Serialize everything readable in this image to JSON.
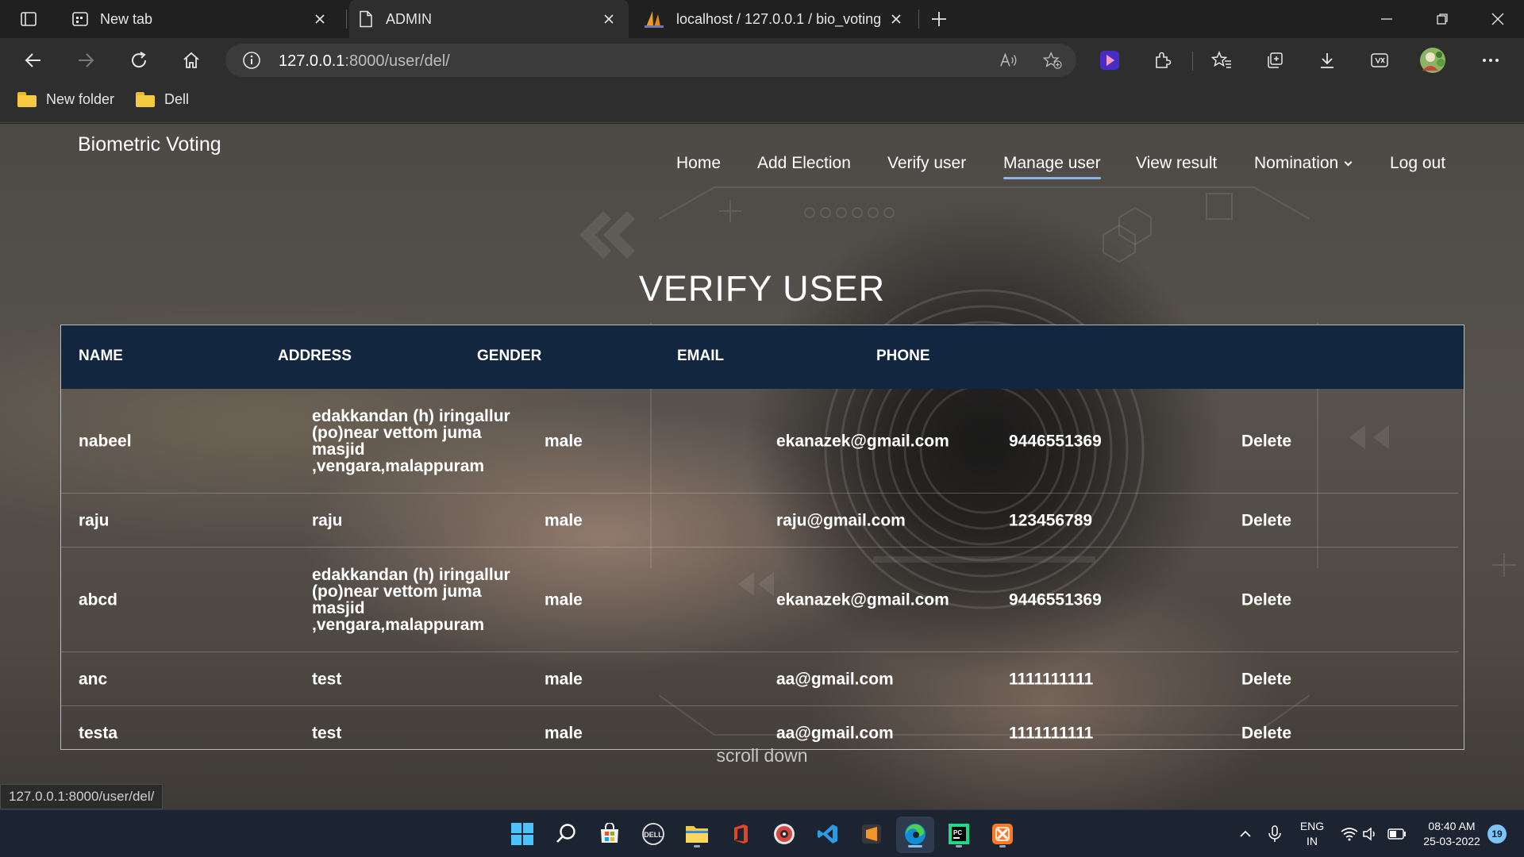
{
  "browser": {
    "tabs": [
      {
        "title": "New tab",
        "icon": "new-tab-page-icon",
        "active": false
      },
      {
        "title": "ADMIN",
        "icon": "document-icon",
        "active": true
      },
      {
        "title": "localhost / 127.0.0.1 / bio_voting",
        "icon": "phpmyadmin-sail-icon",
        "active": false
      }
    ],
    "url_host": "127.0.0.1",
    "url_rest": ":8000/user/del/",
    "bookmarks": [
      {
        "label": "New folder",
        "icon": "folder-icon"
      },
      {
        "label": "Dell",
        "icon": "folder-icon"
      }
    ],
    "status_url": "127.0.0.1:8000/user/del/"
  },
  "site": {
    "brand": "Biometric Voting",
    "nav": {
      "home": "Home",
      "add_election": "Add Election",
      "verify_user": "Verify user",
      "manage_user": "Manage user",
      "view_result": "View result",
      "nomination": "Nomination",
      "logout": "Log out"
    },
    "active_nav": "Manage user",
    "page_title": "VERIFY USER",
    "table": {
      "headers": {
        "name": "NAME",
        "address": "ADDRESS",
        "gender": "GENDER",
        "email": "EMAIL",
        "phone": "PHONE"
      },
      "rows": [
        {
          "name": "nabeel",
          "address_lines": [
            "edakkandan (h) iringallur",
            "(po)near vettom juma",
            "masjid",
            ",vengara,malappuram"
          ],
          "gender": "male",
          "email": "ekanazek@gmail.com",
          "phone": "9446551369",
          "action": "Delete"
        },
        {
          "name": "raju",
          "address_lines": [
            "raju"
          ],
          "gender": "male",
          "email": "raju@gmail.com",
          "phone": "123456789",
          "action": "Delete"
        },
        {
          "name": "abcd",
          "address_lines": [
            "edakkandan (h) iringallur",
            "(po)near vettom juma",
            "masjid",
            ",vengara,malappuram"
          ],
          "gender": "male",
          "email": "ekanazek@gmail.com",
          "phone": "9446551369",
          "action": "Delete"
        },
        {
          "name": "anc",
          "address_lines": [
            "test"
          ],
          "gender": "male",
          "email": "aa@gmail.com",
          "phone": "1111111111",
          "action": "Delete"
        },
        {
          "name": "testa",
          "address_lines": [
            "test"
          ],
          "gender": "male",
          "email": "aa@gmail.com",
          "phone": "1111111111",
          "action": "Delete"
        }
      ]
    },
    "scroll_hint": "scroll down"
  },
  "taskbar": {
    "apps": [
      "windows-start-icon",
      "search-icon",
      "microsoft-store-icon",
      "dell-icon",
      "file-explorer-icon",
      "office-icon",
      "media-player-icon",
      "vscode-icon",
      "sublime-text-icon",
      "edge-browser-icon",
      "pycharm-icon",
      "xampp-icon"
    ],
    "language_top": "ENG",
    "language_bottom": "IN",
    "time": "08:40 AM",
    "date": "25-03-2022",
    "notifications": "19"
  },
  "colors": {
    "table_header_bg": "#12263f",
    "active_nav_underline": "#8fb2e8",
    "taskbar_bg": "#1c2432"
  }
}
